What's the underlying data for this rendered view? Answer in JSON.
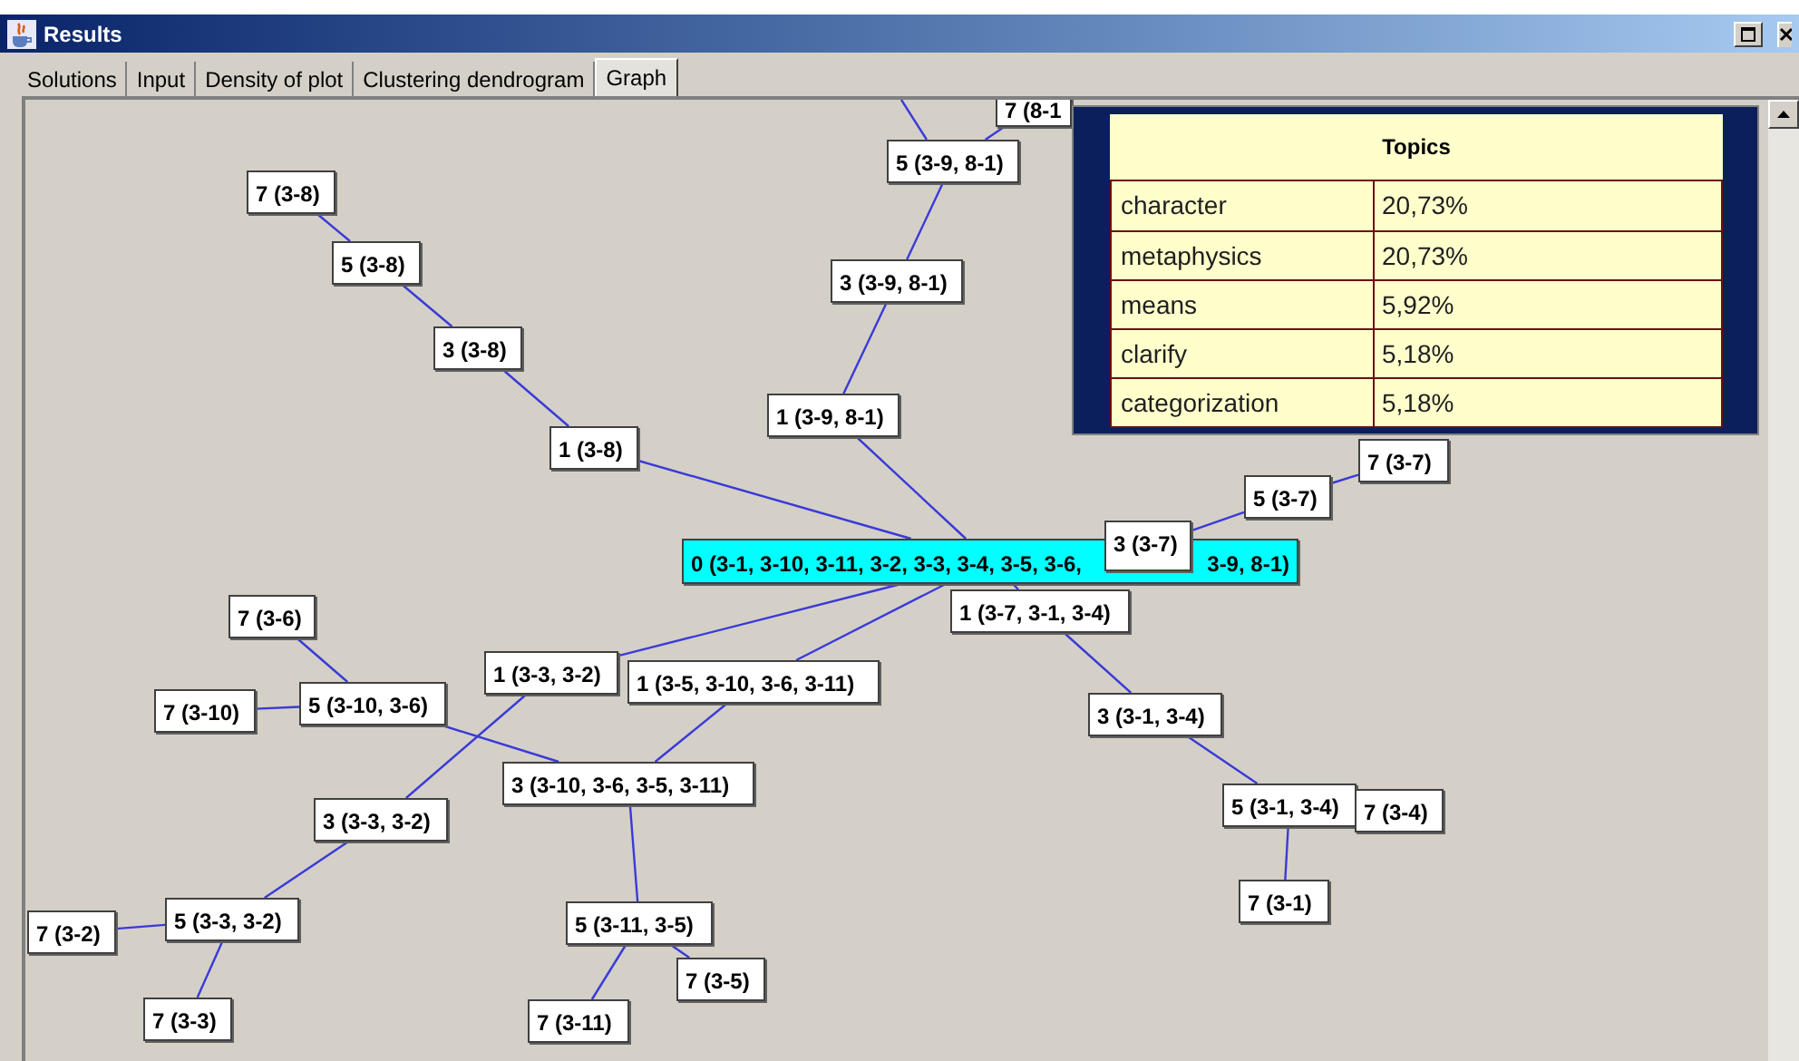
{
  "window": {
    "title": "Results"
  },
  "tabs": [
    {
      "label": "Solutions",
      "selected": false
    },
    {
      "label": "Input",
      "selected": false
    },
    {
      "label": "Density of plot",
      "selected": false
    },
    {
      "label": "Clustering dendrogram",
      "selected": false
    },
    {
      "label": "Graph",
      "selected": true
    }
  ],
  "graph": {
    "root": {
      "kind": "highlighted",
      "label_parts": [
        "0 (3-1, 3-10, 3-11, 3-2, 3-3, 3-4, 3-5, 3-6,",
        "3-9, 8-1)"
      ],
      "children": [
        {
          "label": "1 (3-9, 8-1)",
          "children": [
            {
              "label": "3 (3-9, 8-1)",
              "children": [
                {
                  "label": "5 (3-9, 8-1)",
                  "children": [
                    {
                      "label": "7 (8-1"
                    }
                  ]
                }
              ]
            }
          ]
        },
        {
          "label": "1 (3-8)",
          "children": [
            {
              "label": "3 (3-8)",
              "children": [
                {
                  "label": "5 (3-8)",
                  "children": [
                    {
                      "label": "7 (3-8)"
                    }
                  ]
                }
              ]
            }
          ]
        },
        {
          "label": "1 (3-7, 3-1, 3-4)",
          "children": [
            {
              "label": "3 (3-7)",
              "children": [
                {
                  "label": "5 (3-7)",
                  "children": [
                    {
                      "label": "7 (3-7)"
                    }
                  ]
                }
              ]
            },
            {
              "label": "3 (3-1, 3-4)",
              "children": [
                {
                  "label": "5 (3-1, 3-4)",
                  "children": [
                    {
                      "label": "7 (3-4)"
                    },
                    {
                      "label": "7 (3-1)"
                    }
                  ]
                }
              ]
            }
          ]
        },
        {
          "label": "1 (3-3, 3-2)",
          "children": [
            {
              "label": "3 (3-3, 3-2)",
              "children": [
                {
                  "label": "5 (3-3, 3-2)",
                  "children": [
                    {
                      "label": "7 (3-2)"
                    },
                    {
                      "label": "7 (3-3)"
                    }
                  ]
                }
              ]
            }
          ]
        },
        {
          "label": "1 (3-5, 3-10, 3-6, 3-11)",
          "children": [
            {
              "label": "3 (3-10, 3-6, 3-5, 3-11)",
              "children": [
                {
                  "label": "5 (3-10, 3-6)",
                  "children": [
                    {
                      "label": "7 (3-10)"
                    },
                    {
                      "label": "7 (3-6)"
                    }
                  ]
                },
                {
                  "label": "5 (3-11, 3-5)",
                  "children": [
                    {
                      "label": "7 (3-11)"
                    },
                    {
                      "label": "7 (3-5)"
                    }
                  ]
                }
              ]
            }
          ]
        }
      ]
    }
  },
  "topics": {
    "title": "Topics",
    "rows": [
      {
        "term": "character",
        "share": "20,73%"
      },
      {
        "term": "metaphysics",
        "share": "20,73%"
      },
      {
        "term": "means",
        "share": "5,92%"
      },
      {
        "term": "clarify",
        "share": "5,18%"
      },
      {
        "term": "categorization",
        "share": "5,18%"
      }
    ]
  }
}
